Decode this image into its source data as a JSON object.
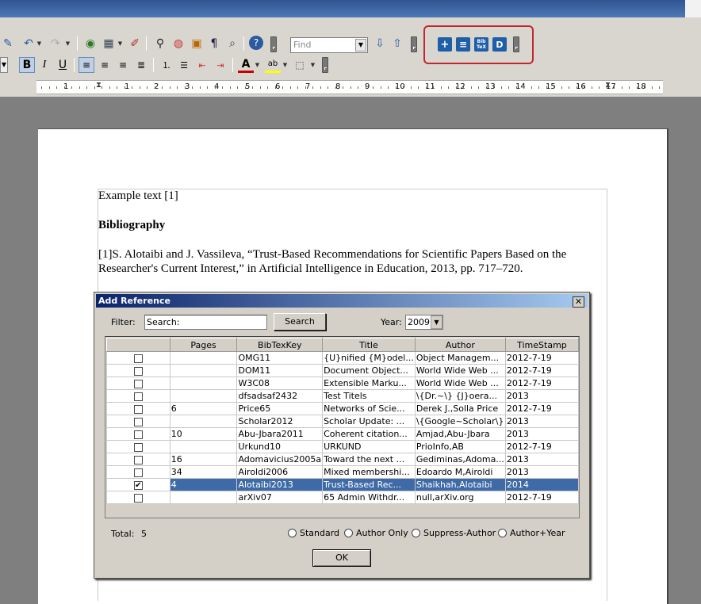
{
  "toolbar": {
    "find_placeholder": "Find",
    "icons": [
      "eraser-icon",
      "undo-icon",
      "redo-icon",
      "navigator-icon",
      "table-icon",
      "draw-icon",
      "binoculars-icon",
      "compass-icon",
      "gallery-icon",
      "pilcrow-icon",
      "zoom-icon",
      "help-icon",
      "find-down-icon",
      "find-up-icon"
    ],
    "bold": "B",
    "italic": "I",
    "underline": "U",
    "font_color_label": "A",
    "highlight_label": "ab"
  },
  "zotero_toolbar": {
    "add_icon": "+",
    "list_icon": "≡",
    "bibtex_top": "Bib",
    "bibtex_bottom": "TeX",
    "doc_icon": "D"
  },
  "ruler": {
    "numbers": [
      "1",
      "1",
      "2",
      "3",
      "4",
      "5",
      "6",
      "7",
      "8",
      "9",
      "10",
      "11",
      "12",
      "13",
      "14",
      "15",
      "16",
      "17",
      "18"
    ]
  },
  "document": {
    "line1": "Example text [1]",
    "heading": "Bibliography",
    "ref_line1": "[1]S. Alotaibi and J. Vassileva, “Trust-Based Recommendations for Scientific Papers Based on the",
    "ref_line2": "Researcher's Current Interest,” in Artificial Intelligence in Education, 2013, pp. 717–720."
  },
  "dialog": {
    "title": "Add Reference",
    "close": "✕",
    "filter_label": "Filter:",
    "search_value": "Search:",
    "search_button": "Search",
    "year_label": "Year:",
    "year_value": "2009",
    "columns": [
      "",
      "Pages",
      "BibTexKey",
      "Title",
      "Author",
      "TimeStamp"
    ],
    "rows": [
      {
        "checked": false,
        "pages": "",
        "key": "OMG11",
        "title": "{U}nified {M}odel...",
        "author": "Object Managem...",
        "ts": "2012-7-19"
      },
      {
        "checked": false,
        "pages": "",
        "key": "DOM11",
        "title": "Document Object...",
        "author": "World Wide Web ...",
        "ts": "2012-7-19"
      },
      {
        "checked": false,
        "pages": "",
        "key": "W3C08",
        "title": "Extensible Marku...",
        "author": "World Wide Web ...",
        "ts": "2012-7-19"
      },
      {
        "checked": false,
        "pages": "",
        "key": "dfsadsaf2432",
        "title": "Test Titels",
        "author": "\\{Dr.~\\} {J}oera...",
        "ts": "2013"
      },
      {
        "checked": false,
        "pages": "6",
        "key": "Price65",
        "title": "Networks of Scie...",
        "author": "Derek J.,Solla Price",
        "ts": "2012-7-19"
      },
      {
        "checked": false,
        "pages": "",
        "key": "Scholar2012",
        "title": "Scholar Update: ...",
        "author": "\\{Google~Scholar\\}",
        "ts": "2013"
      },
      {
        "checked": false,
        "pages": "10",
        "key": "Abu-Jbara2011",
        "title": "Coherent citation...",
        "author": "Amjad,Abu-Jbara",
        "ts": "2013"
      },
      {
        "checked": false,
        "pages": "",
        "key": "Urkund10",
        "title": "URKUND",
        "author": "PrioInfo,AB",
        "ts": "2012-7-19"
      },
      {
        "checked": false,
        "pages": "16",
        "key": "Adomavicius2005a",
        "title": "Toward the next ...",
        "author": "Gediminas,Adoma...",
        "ts": "2013"
      },
      {
        "checked": false,
        "pages": "34",
        "key": "Airoldi2006",
        "title": "Mixed membershi...",
        "author": "Edoardo M,Airoldi",
        "ts": "2013"
      },
      {
        "checked": true,
        "pages": "4",
        "key": "Alotaibi2013",
        "title": "Trust-Based Rec...",
        "author": "Shaikhah,Alotaibi",
        "ts": "2014",
        "selected": true
      },
      {
        "checked": false,
        "pages": "",
        "key": "arXiv07",
        "title": "65 Admin Withdr...",
        "author": "null,arXiv.org",
        "ts": "2012-7-19"
      }
    ],
    "total_label": "Total:",
    "total_value": "5",
    "radios": [
      "Standard",
      "Author Only",
      "Suppress-Author",
      "Author+Year"
    ],
    "ok": "OK"
  },
  "colors": {
    "selection": "#3e6ba7",
    "highlight_box": "#c1272d",
    "dialog_bg": "#d4d0c8"
  }
}
